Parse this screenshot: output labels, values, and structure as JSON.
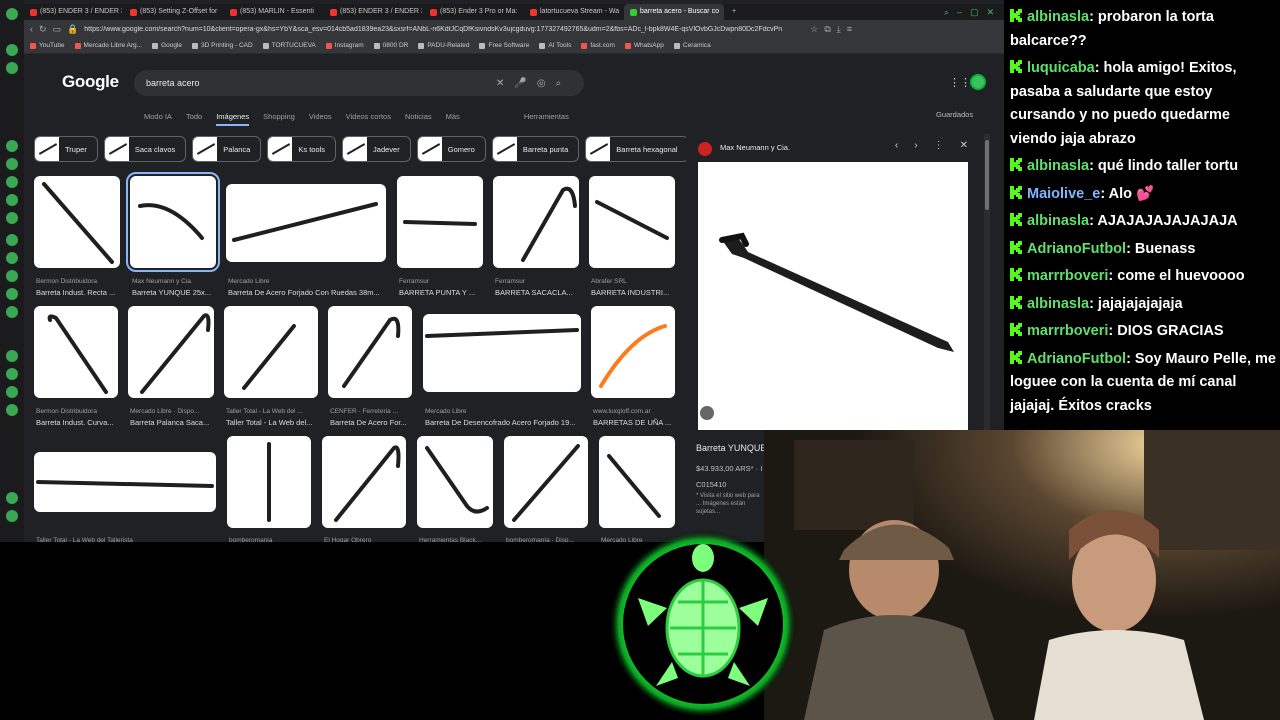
{
  "browser": {
    "tabs": [
      {
        "label": "(853) ENDER 3 / ENDER 3",
        "active": false
      },
      {
        "label": "(853) Setting Z-Offset for",
        "active": false
      },
      {
        "label": "(853) MARLIN - Essenti",
        "active": false
      },
      {
        "label": "(853) ENDER 3 / ENDER 3",
        "active": false
      },
      {
        "label": "(853) Ender 3 Pro or Ma:",
        "active": false
      },
      {
        "label": "latortucueva Stream - Wa",
        "active": false
      },
      {
        "label": "barreta acero - Buscar co",
        "active": true
      }
    ],
    "url": "https://www.google.com/search?num=10&client=opera-gx&hs=YbY&sca_esv=014cb5ad1839ea23&sxsrf=ANbL-n6KdtJCqDfKsivndsKv3ujcgduvg:177327492765&udm=2&fbs=ADc_l-bpk8W4E-qsVlOvbGJcDwpn80Dc2FdcvPn",
    "bookmarks": [
      {
        "label": "YouTube",
        "icon": "youtube-icon"
      },
      {
        "label": "Mercado Libre Arg...",
        "icon": "mercadolibre-icon"
      },
      {
        "label": "Google",
        "icon": "folder-icon"
      },
      {
        "label": "3D Printing - CAD",
        "icon": "folder-icon"
      },
      {
        "label": "TORTUCUEVA",
        "icon": "folder-icon"
      },
      {
        "label": "Instagram",
        "icon": "instagram-icon"
      },
      {
        "label": "0800 DR",
        "icon": "folder-icon"
      },
      {
        "label": "PADU-Related",
        "icon": "folder-icon"
      },
      {
        "label": "Free Software",
        "icon": "folder-icon"
      },
      {
        "label": "AI Tools",
        "icon": "folder-icon"
      },
      {
        "label": "fast.com",
        "icon": "fastcom-icon"
      },
      {
        "label": "WhatsApp",
        "icon": "whatsapp-icon"
      },
      {
        "label": "Ceramica",
        "icon": "folder-icon"
      }
    ]
  },
  "google": {
    "logo": "Google",
    "query": "barreta acero",
    "tabs": [
      "Modo IA",
      "Todo",
      "Imágenes",
      "Shopping",
      "Videos",
      "Videos cortos",
      "Noticias",
      "Más"
    ],
    "active_tab": "Imágenes",
    "tools": "Herramientas",
    "saved": "Guardados",
    "chips": [
      "Truper",
      "Saca clavos",
      "Palanca",
      "Ks tools",
      "Jadever",
      "Gomero",
      "Barreta punta",
      "Barreta hexagonal"
    ]
  },
  "results": [
    {
      "source": "Bermon Distribuidora",
      "title": "Barreta Indust. Recta ..."
    },
    {
      "source": "Max Neumann y Cia.",
      "title": "Barreta YUNQUE 25x..."
    },
    {
      "source": "Mercado Libre",
      "title": "Barreta De Acero Forjado Con Ruedas 38m..."
    },
    {
      "source": "Ferramsur",
      "title": "BARRETA PUNTA Y ..."
    },
    {
      "source": "Ferramsur",
      "title": "BARRETA SACACLA..."
    },
    {
      "source": "Abrafer SRL",
      "title": "BARRETA INDUSTRI..."
    },
    {
      "source": "Bermon Distribuidora",
      "title": "Barreta Indust. Curva..."
    },
    {
      "source": "Mercado Libre · Dispo...",
      "title": "Barreta Palanca Saca..."
    },
    {
      "source": "Taller Total - La Web del ...",
      "title": "Taller Total - La Web del..."
    },
    {
      "source": "CENFER - Ferreteria ...",
      "title": "Barreta De Acero For..."
    },
    {
      "source": "Mercado Libre",
      "title": "Barreta De Desencofrado Acero Forjado 19..."
    },
    {
      "source": "www.luxqloff.com.ar",
      "title": "BARRETAS DE UÑA ..."
    },
    {
      "source": "Taller Total - La Web del Tallerista",
      "title": ""
    },
    {
      "source": "bomberomania",
      "title": ""
    },
    {
      "source": "El Hogar Obrero",
      "title": ""
    },
    {
      "source": "Herramientas Black...",
      "title": ""
    },
    {
      "source": "bomberomanía · Disp...",
      "title": ""
    },
    {
      "source": "Mercado Libre",
      "title": ""
    }
  ],
  "preview": {
    "source": "Max Neumann y Cia.",
    "title": "Barreta YUNQUE",
    "price": "$43.933,00 ARS* · I",
    "code": "C015410",
    "note": "* Visita el sitio web para ... Imágenes están sujetas..."
  },
  "chat": [
    {
      "user": "albinasla",
      "text": ": probaron la torta balcarce??",
      "color": "green"
    },
    {
      "user": "luquicaba",
      "text": ": hola amigo! Exitos, pasaba a saludarte que estoy cursando y no puedo quedarme viendo jaja abrazo",
      "color": "green"
    },
    {
      "user": "albinasla",
      "text": ": qué lindo taller tortu",
      "color": "green"
    },
    {
      "user": "Maiolive_e",
      "text": ": Alo ",
      "color": "blue",
      "emoji": "💕"
    },
    {
      "user": "albinasla",
      "text": ": AJAJAJAJAJAJAJA",
      "color": "green"
    },
    {
      "user": "AdrianoFutbol",
      "text": ": Buenass",
      "color": "green"
    },
    {
      "user": "marrrboveri",
      "text": ": come el huevoooo",
      "color": "green"
    },
    {
      "user": "albinasla",
      "text": ": jajajajajajaja",
      "color": "green"
    },
    {
      "user": "marrrboveri",
      "text": ": DIOS GRACIAS",
      "color": "green"
    },
    {
      "user": "AdrianoFutbol",
      "text": ": Soy Mauro Pelle, me loguee con la cuenta de mí canal jajajaj. Éxitos cracks",
      "color": "green"
    }
  ],
  "colors": {
    "accent": "#3fbf5f",
    "chat_user": "#5ee06a",
    "chat_user_blue": "#82b4ff",
    "link": "#8ab4f8"
  }
}
